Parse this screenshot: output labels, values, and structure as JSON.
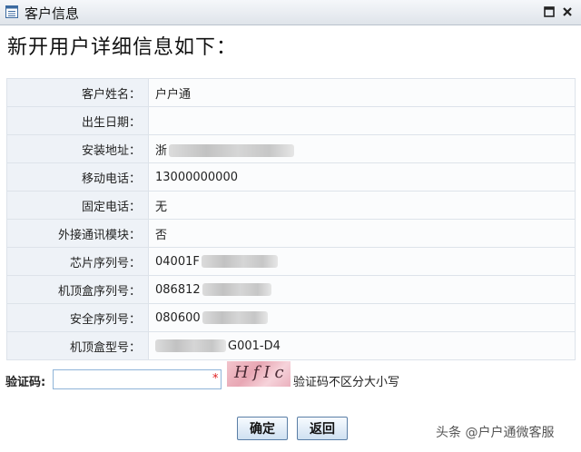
{
  "window": {
    "title": "客户信息"
  },
  "heading": "新开用户详细信息如下：",
  "fields": [
    {
      "label": "客户姓名：",
      "value": "户户通"
    },
    {
      "label": "出生日期：",
      "value": ""
    },
    {
      "label": "安装地址：",
      "value": "浙"
    },
    {
      "label": "移动电话：",
      "value": "13000000000"
    },
    {
      "label": "固定电话：",
      "value": "无"
    },
    {
      "label": "外接通讯模块：",
      "value": "否"
    },
    {
      "label": "芯片序列号：",
      "value": "04001F"
    },
    {
      "label": "机顶盒序列号：",
      "value": "086812"
    },
    {
      "label": "安全序列号：",
      "value": "080600"
    },
    {
      "label": "机顶盒型号：",
      "value": "G001-D4"
    }
  ],
  "captcha": {
    "label": "验证码:",
    "value": "",
    "required_mark": "*",
    "image_text": "HfIc",
    "hint": "验证码不区分大小写"
  },
  "buttons": {
    "confirm": "确定",
    "back": "返回"
  },
  "watermark": "头条 @户户通微客服"
}
